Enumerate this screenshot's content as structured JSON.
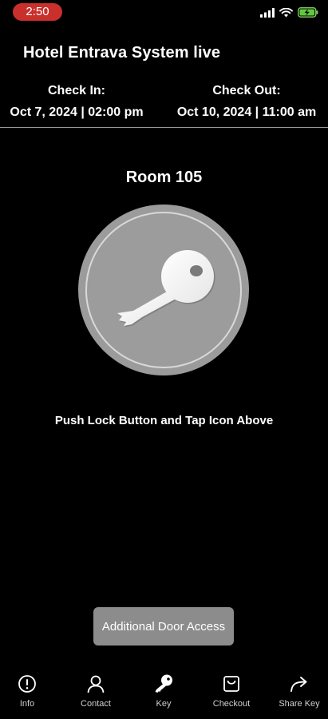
{
  "status_bar": {
    "time": "2:50",
    "accent_color": "#c9302c",
    "icons": [
      "cellular-signal-icon",
      "wifi-icon",
      "battery-charging-icon"
    ]
  },
  "header": {
    "hotel_title": "Hotel Entrava System live"
  },
  "stay": {
    "check_in_label": "Check In:",
    "check_in_value": "Oct 7, 2024 | 02:00 pm",
    "check_out_label": "Check Out:",
    "check_out_value": "Oct 10, 2024 | 11:00 am"
  },
  "room": {
    "title": "Room 105",
    "key_icon": "key-icon"
  },
  "instruction": "Push Lock Button and Tap Icon Above",
  "actions": {
    "door_access_label": "Additional Door Access"
  },
  "tabs": [
    {
      "label": "Info",
      "icon": "info-icon"
    },
    {
      "label": "Contact",
      "icon": "person-icon"
    },
    {
      "label": "Key",
      "icon": "key-icon",
      "active": true
    },
    {
      "label": "Checkout",
      "icon": "checkout-bag-icon"
    },
    {
      "label": "Share Key",
      "icon": "share-arrow-icon"
    }
  ]
}
